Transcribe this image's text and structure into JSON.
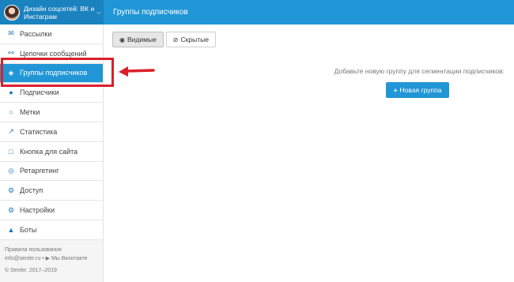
{
  "account": {
    "name": "Дизайн соцсетей: ВК и Инстаграм",
    "chevron_icon": "chevron-down-icon"
  },
  "header": {
    "title": "Группы подписчиков"
  },
  "sidebar": {
    "items": [
      {
        "label": "Рассылки",
        "icon": "envelope-icon"
      },
      {
        "label": "Цепочки сообщений",
        "icon": "chain-icon"
      },
      {
        "label": "Группы подписчиков",
        "icon": "tag-icon",
        "active": true
      },
      {
        "label": "Подписчики",
        "icon": "users-icon"
      },
      {
        "label": "Метки",
        "icon": "circle-icon"
      },
      {
        "label": "Статистика",
        "icon": "chart-icon"
      },
      {
        "label": "Кнопка для сайта",
        "icon": "file-icon"
      },
      {
        "label": "Ретаргетинг",
        "icon": "target-icon"
      },
      {
        "label": "Доступ",
        "icon": "key-icon"
      },
      {
        "label": "Настройки",
        "icon": "gears-icon"
      },
      {
        "label": "Боты",
        "icon": "android-icon"
      }
    ],
    "footer": {
      "rules": "Правила пользования",
      "email": "info@senler.ru",
      "sep": "•",
      "vk": "Мы Вконтакте",
      "copyright": "© Senler, 2017–2019"
    }
  },
  "tabs": [
    {
      "label": "Видимые",
      "icon": "eye-icon",
      "active": true
    },
    {
      "label": "Скрытые",
      "icon": "eye-slash-icon"
    }
  ],
  "empty": {
    "text": "Добавьте новую группу для сегментации подписчиков:",
    "button": "Новая группа",
    "button_icon": "plus"
  },
  "colors": {
    "accent": "#2196d6",
    "account_bg": "#1a82bf",
    "annotation": "#d9202b"
  }
}
